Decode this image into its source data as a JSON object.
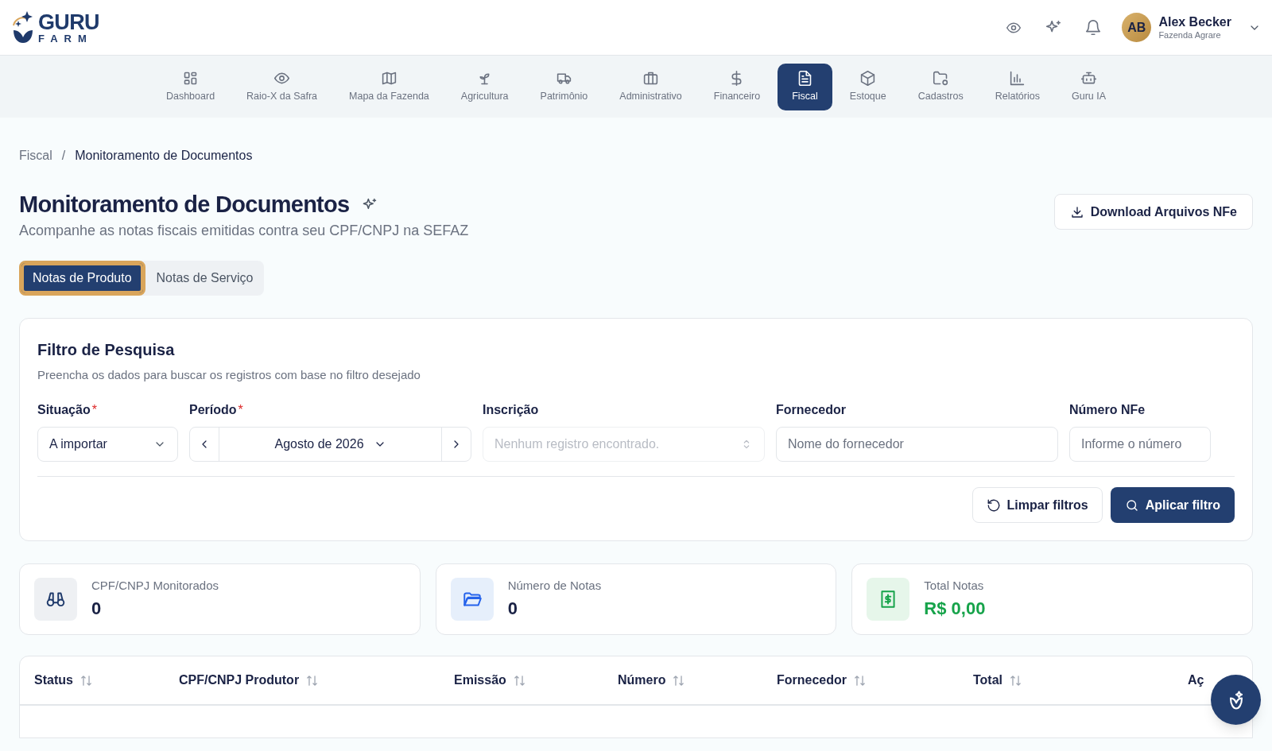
{
  "header": {
    "logo": {
      "line_1": "GURU",
      "line_2": "FARM"
    },
    "user": {
      "initials": "AB",
      "name": "Alex Becker",
      "farm": "Fazenda Agrare"
    }
  },
  "nav": [
    {
      "label": "Dashboard",
      "selected": false
    },
    {
      "label": "Raio-X da Safra",
      "selected": false
    },
    {
      "label": "Mapa da Fazenda",
      "selected": false
    },
    {
      "label": "Agricultura",
      "selected": false
    },
    {
      "label": "Patrimônio",
      "selected": false
    },
    {
      "label": "Administrativo",
      "selected": false
    },
    {
      "label": "Financeiro",
      "selected": false
    },
    {
      "label": "Fiscal",
      "selected": true
    },
    {
      "label": "Estoque",
      "selected": false
    },
    {
      "label": "Cadastros",
      "selected": false
    },
    {
      "label": "Relatórios",
      "selected": false
    },
    {
      "label": "Guru IA",
      "selected": false
    }
  ],
  "breadcrumb": {
    "items": [
      "Fiscal",
      "Monitoramento de Documentos"
    ],
    "separator": "/"
  },
  "page": {
    "title": "Monitoramento de Documentos",
    "subtitle": "Acompanhe as notas fiscais emitidas contra seu CPF/CNPJ na SEFAZ",
    "download_button": "Download Arquivos NFe"
  },
  "tabs": [
    {
      "label": "Notas de Produto",
      "selected": true
    },
    {
      "label": "Notas de Serviço",
      "selected": false
    }
  ],
  "filter": {
    "title": "Filtro de Pesquisa",
    "description": "Preencha os dados para buscar os registros com base no filtro desejado",
    "fields": [
      {
        "kind": "select",
        "label": "Situação",
        "required_mark": "*",
        "value": "A importar"
      },
      {
        "kind": "period",
        "label": "Período",
        "required_mark": "*",
        "value": "Agosto de 2026"
      },
      {
        "kind": "combobox",
        "label": "Inscrição",
        "disabled": true,
        "placeholder": "Nenhum registro encontrado."
      },
      {
        "kind": "text",
        "label": "Fornecedor",
        "placeholder": "Nome do fornecedor"
      },
      {
        "kind": "text",
        "label": "Número NFe",
        "placeholder": "Informe o número"
      }
    ],
    "clear_button": "Limpar filtros",
    "apply_button": "Aplicar filtro"
  },
  "stats": [
    {
      "kind": "count",
      "label": "CPF/CNPJ Monitorados",
      "value": "0"
    },
    {
      "kind": "count",
      "label": "Número de Notas",
      "value": "0"
    },
    {
      "kind": "currency",
      "label": "Total Notas",
      "value": "R$ 0,00"
    }
  ],
  "table": {
    "columns": [
      {
        "label": "Status",
        "sortable": true
      },
      {
        "label": "CPF/CNPJ Produtor",
        "sortable": true
      },
      {
        "label": "Emissão",
        "sortable": true
      },
      {
        "label": "Número",
        "sortable": true
      },
      {
        "label": "Fornecedor",
        "sortable": true
      },
      {
        "label": "Total",
        "sortable": true
      },
      {
        "label": "Aç",
        "sortable": false
      }
    ]
  }
}
